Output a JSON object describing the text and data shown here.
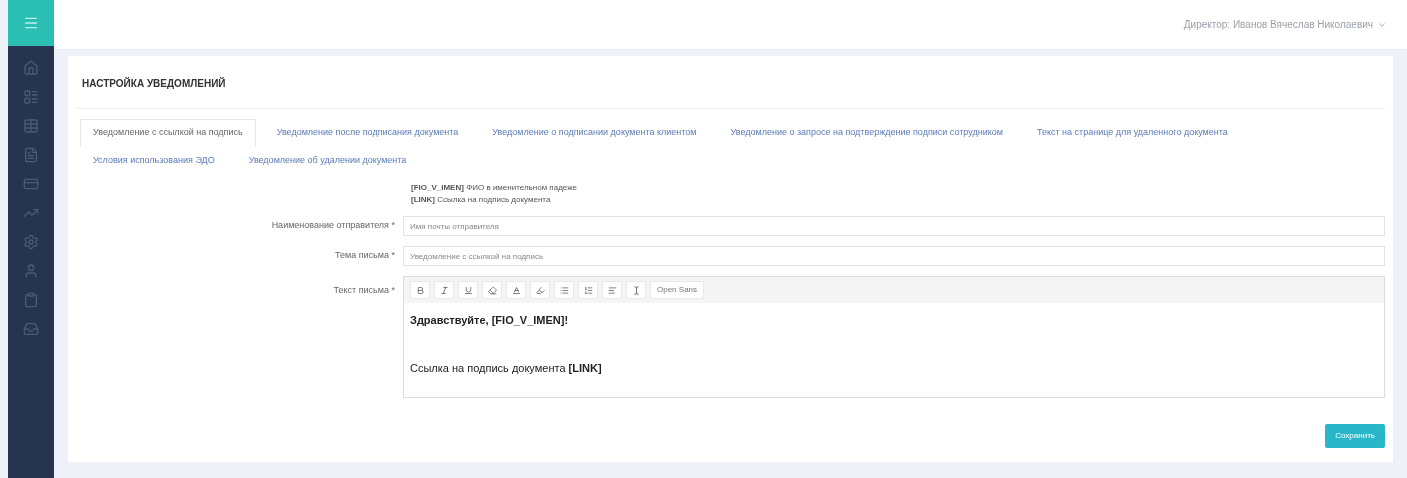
{
  "header": {
    "user": "Директор: Иванов Вячеслав Николаевич"
  },
  "page": {
    "title": "НАСТРОЙКА УВЕДОМЛЕНИЙ"
  },
  "tabs": [
    {
      "label": "Уведомление с ссылкой на подпись",
      "selected": true
    },
    {
      "label": "Уведомление после подписания документа",
      "selected": false
    },
    {
      "label": "Уведомление о подписании документа клиентом",
      "selected": false
    },
    {
      "label": "Уведомление о запросе на подтверждение подписи сотрудником",
      "selected": false
    },
    {
      "label": "Текст на странице для удаленного документа",
      "selected": false
    },
    {
      "label": "Условия использования ЭДО",
      "selected": false
    },
    {
      "label": "Уведомление об удалении документа",
      "selected": false
    }
  ],
  "hints": [
    "**[FIO_V_IMEN]** ФИО в именительном падеже",
    "**[LINK]** Ссылка на подпись документа"
  ],
  "fields": [
    {
      "label": "Наименование отправителя *",
      "value": "Имя почты отправителя"
    },
    {
      "label": "Тема письма *",
      "value": "Уведомление с ссылкой на подпись"
    }
  ],
  "editor": {
    "label": "Текст письма *",
    "font": "Open Sans",
    "paragraphs": [
      "**Здравствуйте, [FIO_V_IMEN]!**",
      "Ссылка на подпись документа **[LINK]**"
    ]
  },
  "save_button": "Сохранить"
}
